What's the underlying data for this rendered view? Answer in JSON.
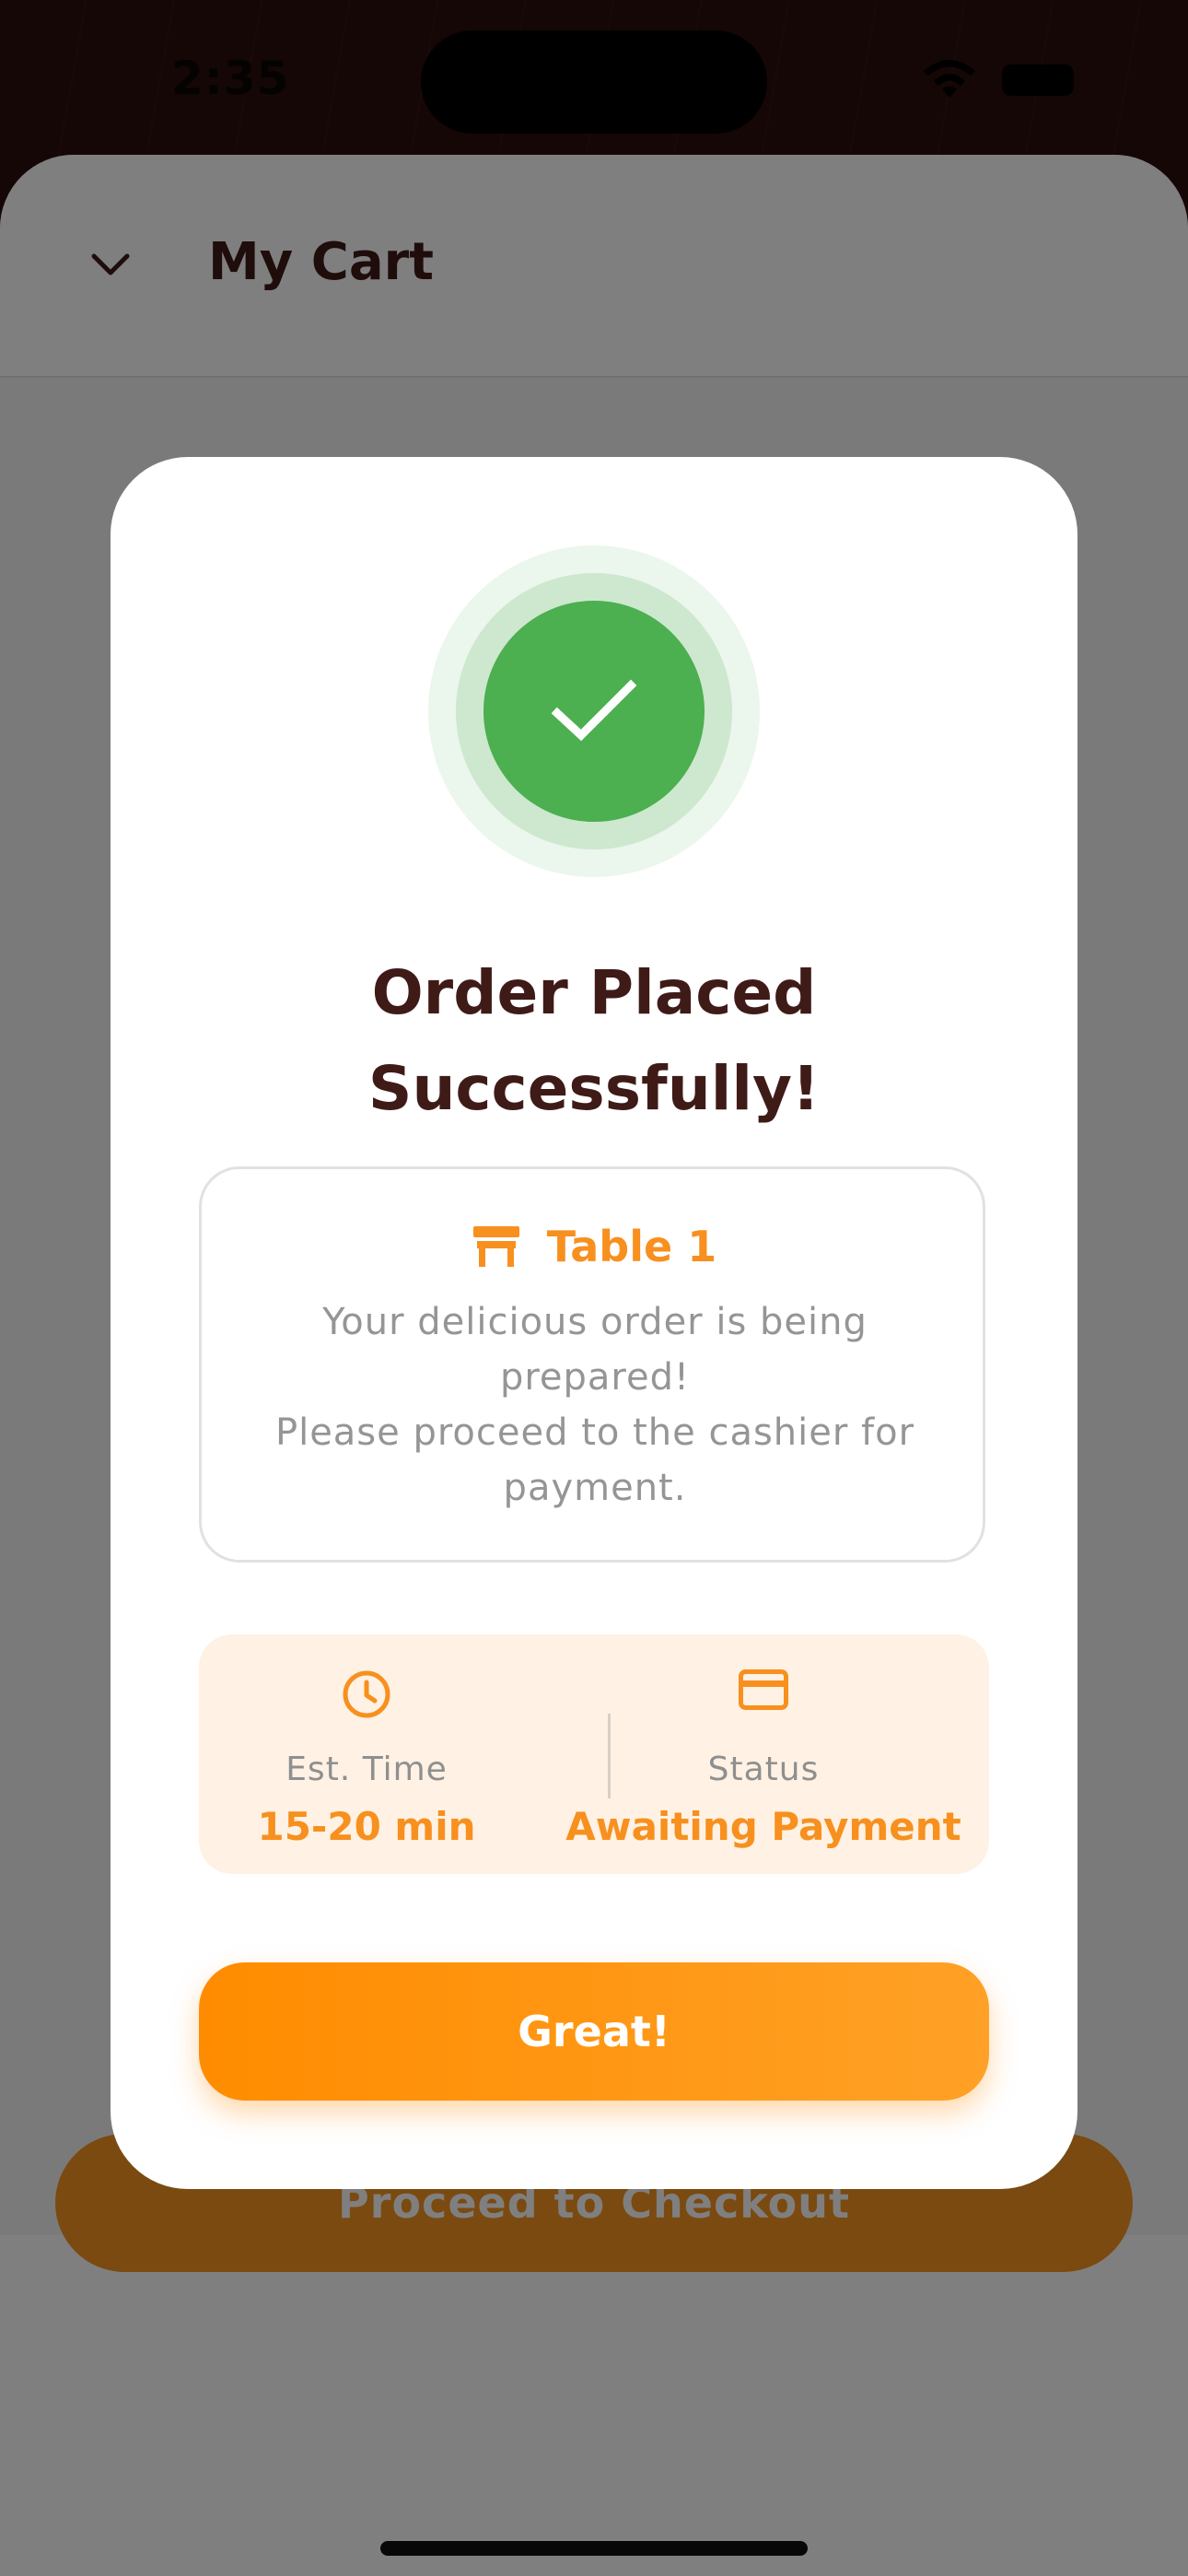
{
  "status_bar": {
    "time": "2:35"
  },
  "header": {
    "title": "My Cart",
    "back_icon": "chevron-down-icon"
  },
  "footer": {
    "checkout_label": "Proceed to Checkout"
  },
  "dialog": {
    "icon": "checkmark-icon",
    "title_line1": "Order Placed",
    "title_line2": "Successfully!",
    "table": {
      "icon": "table-icon",
      "label": "Table 1"
    },
    "message_line1": "Your delicious order is being prepared!",
    "message_line2": "Please proceed to the cashier for payment.",
    "est_time": {
      "icon": "clock-icon",
      "label": "Est. Time",
      "value": "15-20 min"
    },
    "status": {
      "icon": "credit-card-icon",
      "label": "Status",
      "value": "Awaiting Payment"
    },
    "confirm_label": "Great!"
  },
  "colors": {
    "accent": "#f7901e",
    "success": "#4caf50",
    "title": "#3f1b18"
  }
}
